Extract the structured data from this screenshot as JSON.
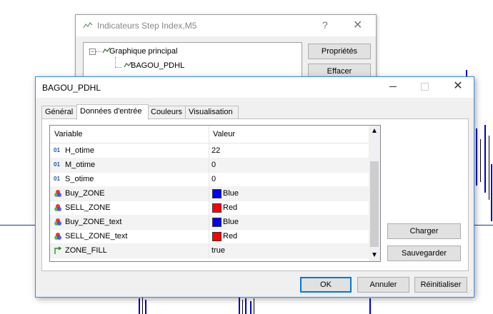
{
  "background_dialog": {
    "title": "Indicateurs Step Index,M5",
    "help_glyph": "?",
    "close_glyph": "✕",
    "tree": {
      "root": "Graphique principal",
      "child": "BAGOU_PDHL"
    },
    "buttons": {
      "properties": "Propriétés",
      "delete": "Effacer"
    }
  },
  "dialog": {
    "title": "BAGOU_PDHL",
    "close_glyph": "✕",
    "tabs": [
      "Général",
      "Données d'entrée",
      "Couleurs",
      "Visualisation"
    ],
    "active_tab": "Données d'entrée",
    "grid": {
      "headers": {
        "variable": "Variable",
        "value": "Valeur"
      },
      "rows": [
        {
          "icon": "int-icon",
          "name": "H_otime",
          "value": "22"
        },
        {
          "icon": "int-icon",
          "name": "M_otime",
          "value": "0"
        },
        {
          "icon": "int-icon",
          "name": "S_otime",
          "value": "0"
        },
        {
          "icon": "color-icon",
          "name": "Buy_ZONE",
          "value": "Blue",
          "color": "#0000ff"
        },
        {
          "icon": "color-icon",
          "name": "SELL_ZONE",
          "value": "Red",
          "color": "#ff0000"
        },
        {
          "icon": "color-icon",
          "name": "Buy_ZONE_text",
          "value": "Blue",
          "color": "#0000ff"
        },
        {
          "icon": "color-icon",
          "name": "SELL_ZONE_text",
          "value": "Red",
          "color": "#ff0000"
        },
        {
          "icon": "bool-icon",
          "name": "ZONE_FILL",
          "value": "true"
        }
      ]
    },
    "side_buttons": {
      "load": "Charger",
      "save": "Sauvegarder"
    },
    "footer_buttons": {
      "ok": "OK",
      "cancel": "Annuler",
      "reset": "Réinitialiser"
    }
  }
}
